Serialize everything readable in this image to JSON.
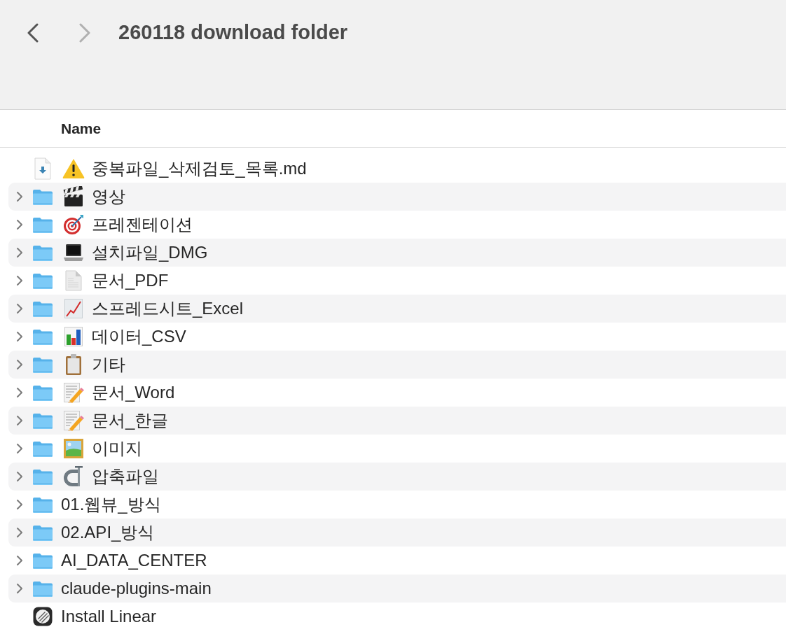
{
  "window": {
    "title": "260118 download folder"
  },
  "toolbar": {
    "back": {
      "disabled": false
    },
    "forward": {
      "disabled": true
    }
  },
  "table": {
    "columns": [
      "Name"
    ],
    "rows": [
      {
        "kind": "file",
        "emoji": {
          "kind": "warning"
        },
        "name": "중복파일_삭제검토_목록.md"
      },
      {
        "kind": "folder",
        "expanded": false,
        "emoji": {
          "kind": "clapperboard"
        },
        "name": "영상"
      },
      {
        "kind": "folder",
        "expanded": false,
        "emoji": {
          "kind": "target"
        },
        "name": "프레젠테이션"
      },
      {
        "kind": "folder",
        "expanded": false,
        "emoji": {
          "kind": "laptop"
        },
        "name": "설치파일_DMG"
      },
      {
        "kind": "folder",
        "expanded": false,
        "emoji": {
          "kind": "document"
        },
        "name": "문서_PDF"
      },
      {
        "kind": "folder",
        "expanded": false,
        "emoji": {
          "kind": "linechart"
        },
        "name": "스프레드시트_Excel"
      },
      {
        "kind": "folder",
        "expanded": false,
        "emoji": {
          "kind": "barchart"
        },
        "name": "데이터_CSV"
      },
      {
        "kind": "folder",
        "expanded": false,
        "emoji": {
          "kind": "clipboard"
        },
        "name": "기타"
      },
      {
        "kind": "folder",
        "expanded": false,
        "emoji": {
          "kind": "memo"
        },
        "name": "문서_Word"
      },
      {
        "kind": "folder",
        "expanded": false,
        "emoji": {
          "kind": "memo"
        },
        "name": "문서_한글"
      },
      {
        "kind": "folder",
        "expanded": false,
        "emoji": {
          "kind": "picture"
        },
        "name": "이미지"
      },
      {
        "kind": "folder",
        "expanded": false,
        "emoji": {
          "kind": "clamp"
        },
        "name": "압축파일"
      },
      {
        "kind": "folder",
        "expanded": false,
        "name": "01.웹뷰_방식"
      },
      {
        "kind": "folder",
        "expanded": false,
        "name": "02.API_방식"
      },
      {
        "kind": "folder",
        "expanded": false,
        "name": "AI_DATA_CENTER"
      },
      {
        "kind": "folder",
        "expanded": false,
        "name": "claude-plugins-main"
      },
      {
        "kind": "app",
        "name": "Install Linear"
      }
    ]
  }
}
